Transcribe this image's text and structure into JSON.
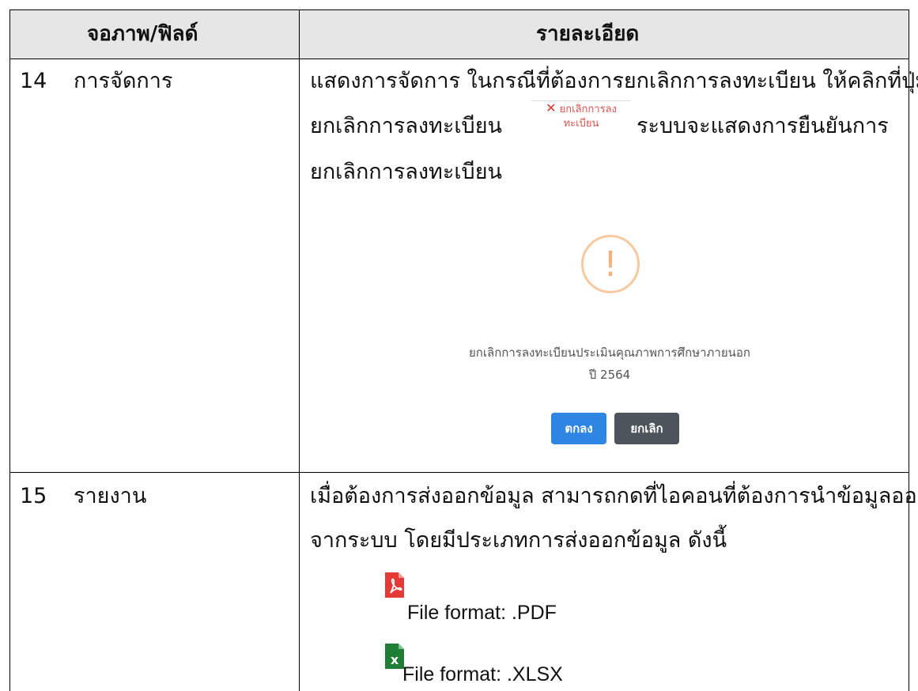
{
  "table": {
    "headers": [
      "จอภาพ/ฟิลด์",
      "รายละเอียด"
    ],
    "rows": [
      {
        "no": "14",
        "field": "การจัดการ",
        "desc_lines": [
          "แสดงการจัดการ ในกรณีที่ต้องการยกเลิกการลงทะเบียน ให้คลิกที่ปุ่ม",
          "ยกเลิกการลงทะเบียน",
          "ระบบจะแสดงการยืนยันการ",
          "ยกเลิกการลงทะเบียน"
        ],
        "inline_button": {
          "line1": "ยกเลิกการลง",
          "line2": "ทะเบียน"
        },
        "dialog": {
          "message": "ยกเลิกการลงทะเบียนประเมินคุณภาพการศึกษาภายนอก",
          "year": "ปี 2564",
          "confirm_label": "ตกลง",
          "cancel_label": "ยกเลิก"
        }
      },
      {
        "no": "15",
        "field": "รายงาน",
        "desc_lines": [
          "เมื่อต้องการส่งออกข้อมูล สามารถกดที่ไอคอนที่ต้องการนำข้อมูลออก",
          "จากระบบ โดยมีประเภทการส่งออกข้อมูล ดังนี้"
        ],
        "formats": [
          {
            "icon": "pdf-icon",
            "label": "File format: .PDF",
            "color": "#e53935"
          },
          {
            "icon": "xlsx-icon",
            "label": "File format: .XLSX",
            "color": "#1e7e34"
          }
        ]
      }
    ]
  }
}
